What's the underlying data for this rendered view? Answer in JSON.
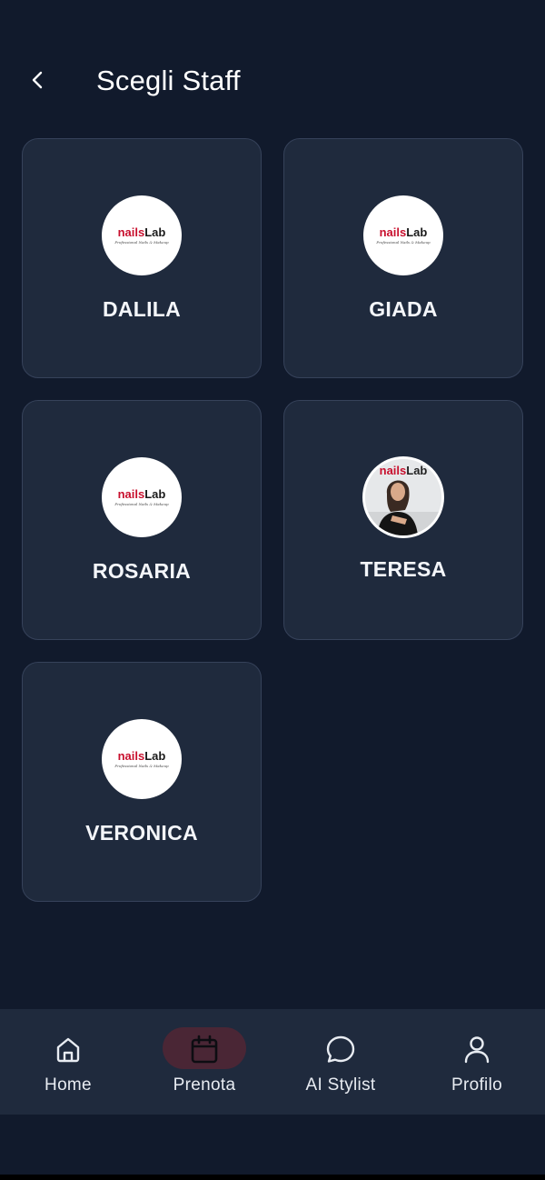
{
  "header": {
    "title": "Scegli Staff",
    "back_icon": "chevron-left-icon"
  },
  "logo": {
    "main_n": "nails",
    "main_l": "Lab",
    "subtitle": "Professional Nails & Makeup"
  },
  "staff": [
    {
      "name": "DALILA",
      "avatar": "logo"
    },
    {
      "name": "GIADA",
      "avatar": "logo"
    },
    {
      "name": "ROSARIA",
      "avatar": "logo"
    },
    {
      "name": "TERESA",
      "avatar": "photo"
    },
    {
      "name": "VERONICA",
      "avatar": "logo"
    }
  ],
  "nav": {
    "items": [
      {
        "label": "Home",
        "icon": "home-icon",
        "active": false
      },
      {
        "label": "Prenota",
        "icon": "calendar-icon",
        "active": true
      },
      {
        "label": "AI Stylist",
        "icon": "chat-bubble-icon",
        "active": false
      },
      {
        "label": "Profilo",
        "icon": "user-icon",
        "active": false
      }
    ]
  },
  "colors": {
    "background": "#111a2c",
    "card": "#1f2a3d",
    "card_border": "#36425a",
    "active_pill": "#4a2635",
    "logo_red": "#c8102e"
  }
}
